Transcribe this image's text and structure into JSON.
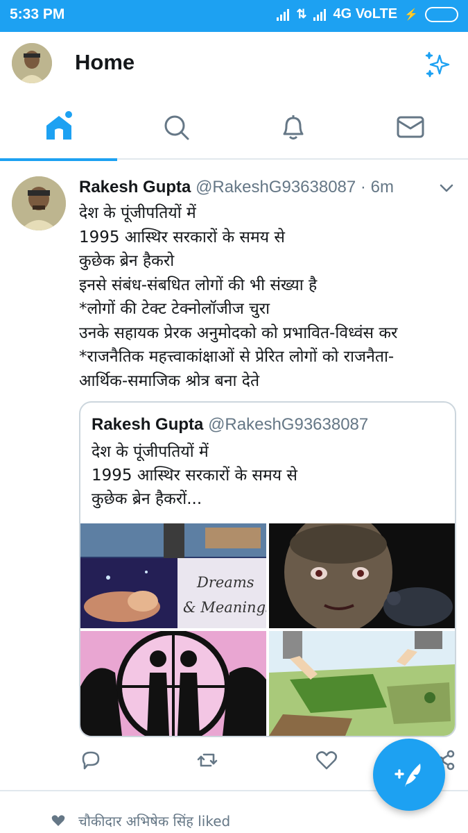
{
  "status_bar": {
    "time": "5:33 PM",
    "network": "4G VoLTE"
  },
  "header": {
    "title": "Home"
  },
  "tabs": [
    {
      "name": "home",
      "icon": "home-icon",
      "active": true
    },
    {
      "name": "search",
      "icon": "search-icon",
      "active": false
    },
    {
      "name": "notifications",
      "icon": "bell-icon",
      "active": false
    },
    {
      "name": "messages",
      "icon": "mail-icon",
      "active": false
    }
  ],
  "tweet": {
    "author_name": "Rakesh Gupta",
    "handle": "@RakeshG93638087",
    "separator": "·",
    "time": "6m",
    "lines": [
      "देश के पूंजीपतियों में",
      "1995 आस्थिर सरकारों के समय से",
      "कुछेक ब्रेन हैकरो",
      "इनसे संबंध-संबधित लोगों की भी संख्या है",
      "*लोगों की टेक्ट टेक्नोलॉजीज चुरा",
      "उनके सहायक प्रेरक अनुमोदको को प्रभावित-विध्वंस कर",
      "*राजनैतिक महत्त्वाकांक्षाओं से प्रेरित लोगों को राजनैता-",
      "आर्थिक-समाजिक श्रोत्र बना देते"
    ],
    "quote": {
      "author_name": "Rakesh Gupta",
      "handle": "@RakeshG93638087",
      "lines": [
        "देश के पूंजीपतियों में",
        "1995 आस्थिर सरकारों के समय से",
        "कुछेक ब्रेन हैकरों..."
      ],
      "media": [
        {
          "caption_line1": "Dreams",
          "caption_line2": "& Meanings"
        },
        {
          "caption_line1": "",
          "caption_line2": ""
        },
        {
          "caption_line1": "",
          "caption_line2": ""
        },
        {
          "caption_line1": "",
          "caption_line2": ""
        }
      ]
    }
  },
  "next_item": {
    "liked_text": "चौकीदार अभिषेक सिंह liked"
  },
  "colors": {
    "brand": "#1da1f2",
    "text": "#14171a",
    "muted": "#657786",
    "border": "#e1e8ed"
  }
}
